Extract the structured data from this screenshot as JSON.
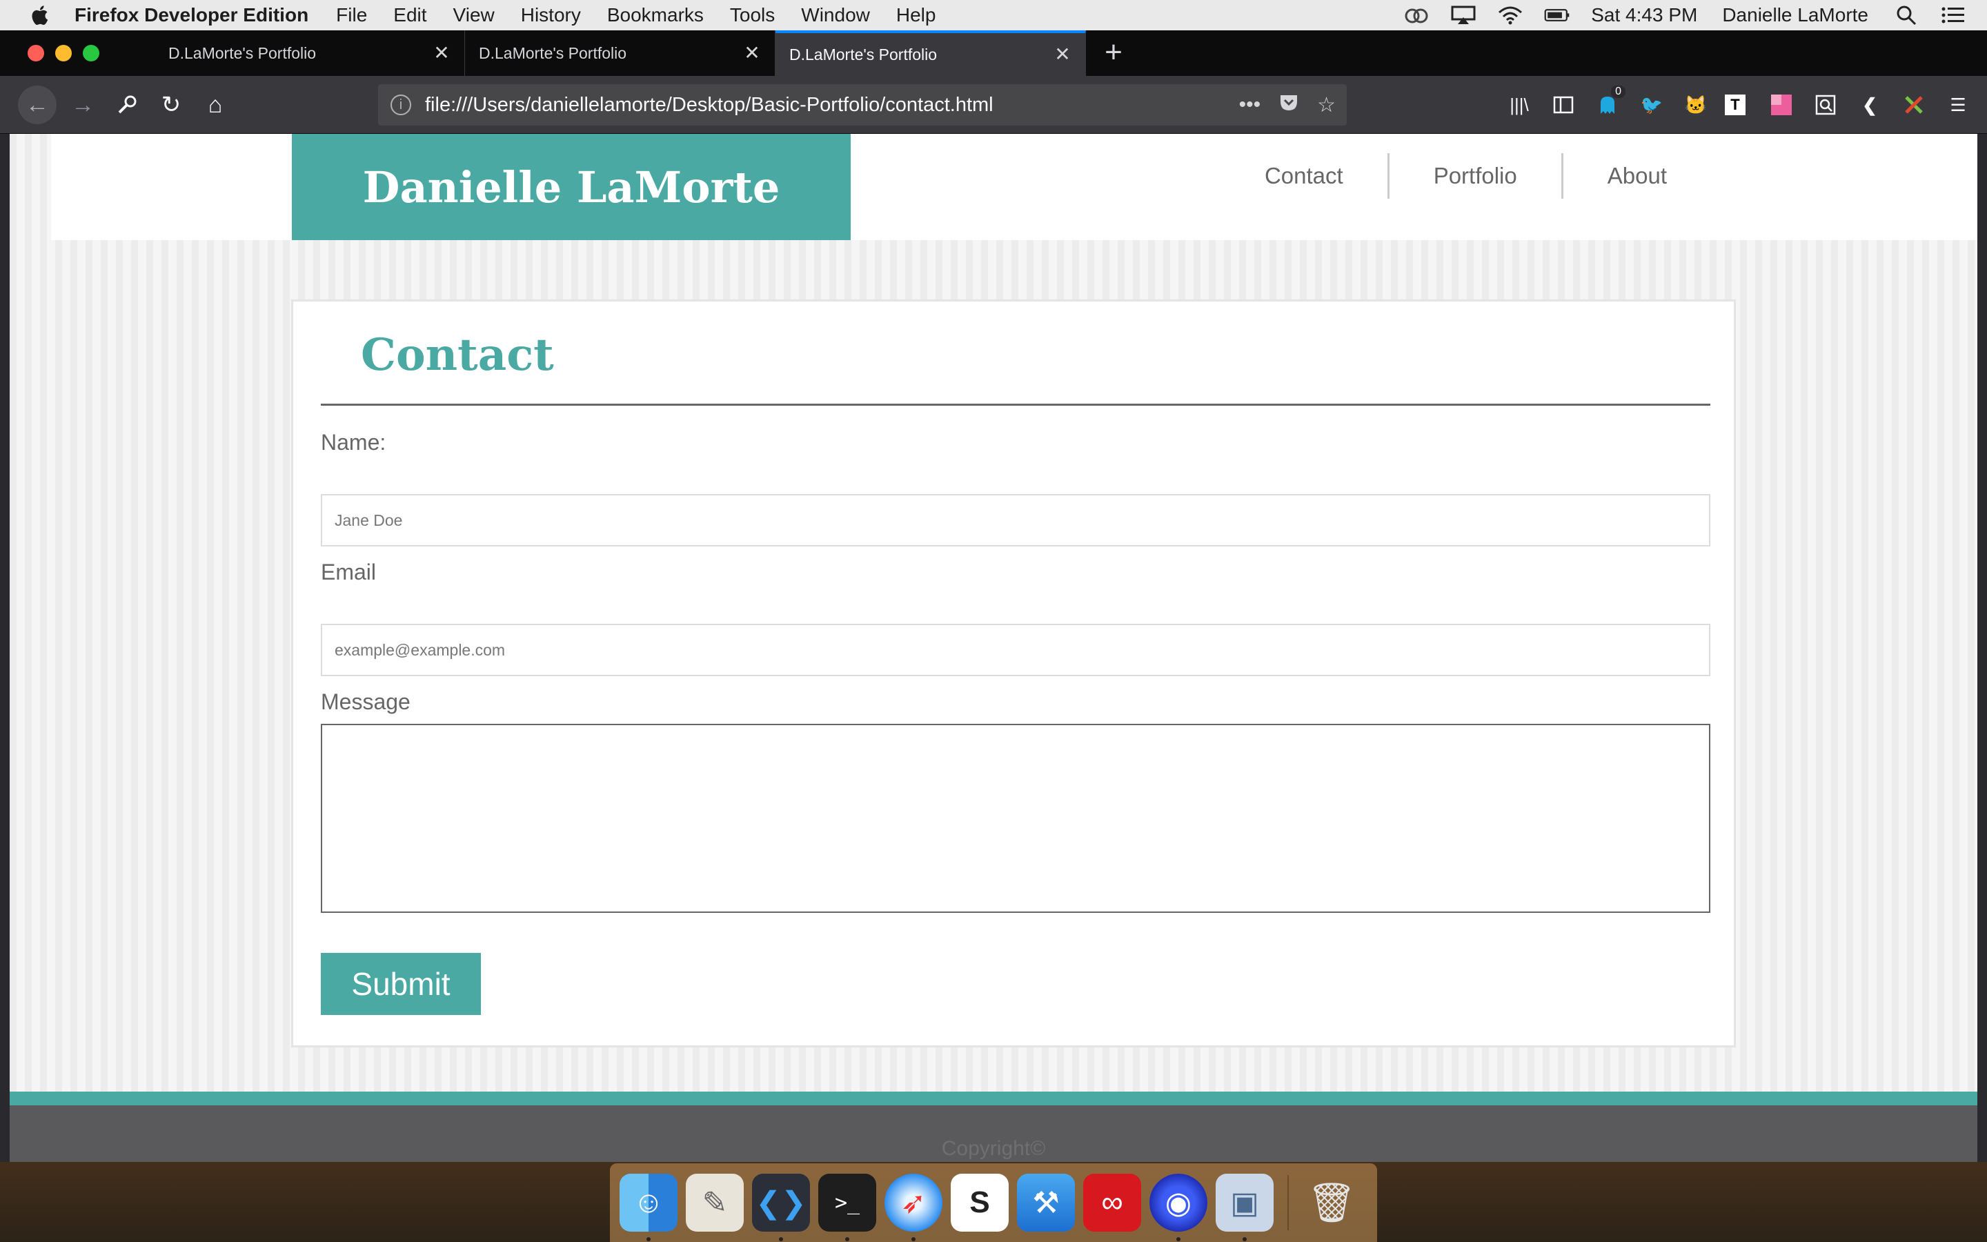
{
  "menubar": {
    "app_name": "Firefox Developer Edition",
    "items": [
      "File",
      "Edit",
      "View",
      "History",
      "Bookmarks",
      "Tools",
      "Window",
      "Help"
    ],
    "clock": "Sat 4:43 PM",
    "user": "Danielle LaMorte"
  },
  "browser": {
    "tabs": [
      {
        "title": "D.LaMorte's Portfolio",
        "active": false
      },
      {
        "title": "D.LaMorte's Portfolio",
        "active": false
      },
      {
        "title": "D.LaMorte's Portfolio",
        "active": true
      }
    ],
    "url": "file:///Users/daniellelamorte/Desktop/Basic-Portfolio/contact.html",
    "badge_count": "0"
  },
  "site": {
    "logo": "Danielle LaMorte",
    "nav": [
      "Contact",
      "Portfolio",
      "About"
    ],
    "accent_color": "#4aa9a2"
  },
  "contact": {
    "heading": "Contact",
    "name_label": "Name:",
    "name_placeholder": "Jane Doe",
    "email_label": "Email",
    "email_placeholder": "example@example.com",
    "message_label": "Message",
    "submit_label": "Submit"
  },
  "footer": {
    "copyright": "Copyright©"
  },
  "dock": {
    "apps": [
      "finder-icon",
      "text-edit-icon",
      "vscode-icon",
      "terminal-icon",
      "safari-icon",
      "slack-icon",
      "xcode-icon",
      "creative-cloud-icon",
      "firefox-icon",
      "preview-icon",
      "trash-icon"
    ]
  }
}
